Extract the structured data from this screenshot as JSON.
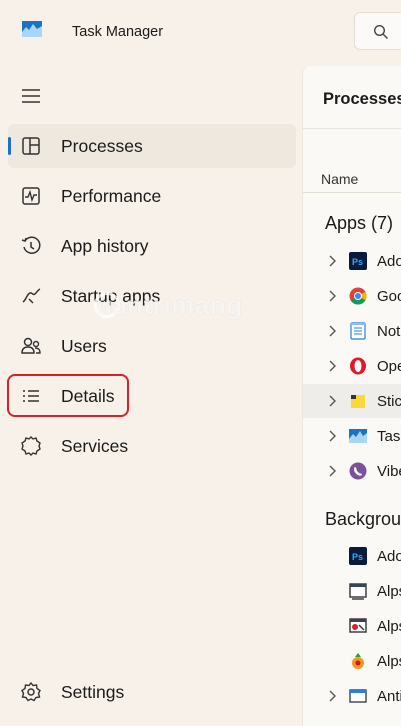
{
  "window": {
    "title": "Task Manager"
  },
  "nav": {
    "items": [
      {
        "label": "Processes",
        "icon": "processes-icon",
        "active": true
      },
      {
        "label": "Performance",
        "icon": "performance-icon"
      },
      {
        "label": "App history",
        "icon": "app-history-icon"
      },
      {
        "label": "Startup apps",
        "icon": "startup-apps-icon"
      },
      {
        "label": "Users",
        "icon": "users-icon"
      },
      {
        "label": "Details",
        "icon": "details-icon",
        "highlighted": true
      },
      {
        "label": "Services",
        "icon": "services-icon"
      }
    ],
    "settings_label": "Settings"
  },
  "main": {
    "title": "Processes",
    "column_name": "Name",
    "apps_group": "Apps (7)",
    "apps": [
      {
        "name": "Ado",
        "icon": "photoshop-icon"
      },
      {
        "name": "Goo",
        "icon": "chrome-icon"
      },
      {
        "name": "Not",
        "icon": "notepad-icon"
      },
      {
        "name": "Ope",
        "icon": "opera-icon"
      },
      {
        "name": "Stic",
        "icon": "sticky-notes-icon"
      },
      {
        "name": "Task",
        "icon": "task-manager-icon"
      },
      {
        "name": "Vibe",
        "icon": "viber-icon"
      }
    ],
    "background_group": "Backgrou",
    "background": [
      {
        "name": "Ado",
        "icon": "photoshop-icon"
      },
      {
        "name": "Alps",
        "icon": "alps-window-icon"
      },
      {
        "name": "Alps",
        "icon": "alps-tool-icon"
      },
      {
        "name": "Alps",
        "icon": "alps-pointer-icon"
      },
      {
        "name": "Anti",
        "icon": "antimalware-icon"
      }
    ]
  },
  "watermark": "uantrimang",
  "colors": {
    "background": "#f7f1e9",
    "accent": "#1f6fc8",
    "highlight_border": "#d8202a"
  }
}
